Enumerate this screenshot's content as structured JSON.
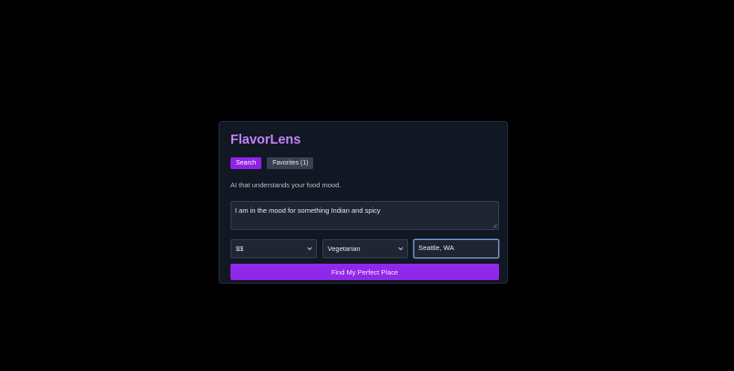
{
  "app": {
    "title": "FlavorLens",
    "tabs": [
      {
        "label": "Search",
        "active": true
      },
      {
        "label": "Favorites (1)",
        "active": false
      }
    ],
    "tagline": "AI that understands your food mood."
  },
  "form": {
    "mood_query": "I am in the mood for something Indian and spicy",
    "price_select": {
      "value": "$$",
      "icon": "chevron-down-icon"
    },
    "diet_select": {
      "value": "Vegetarian",
      "icon": "chevron-down-icon"
    },
    "location_input": {
      "value": "Seattle, WA"
    },
    "submit_label": "Find My Perfect Place"
  },
  "colors": {
    "page_bg": "#000000",
    "card_bg": "#111723",
    "accent": "#9028ea",
    "title": "#c283f6",
    "focus_ring": "#7b9bd1"
  }
}
